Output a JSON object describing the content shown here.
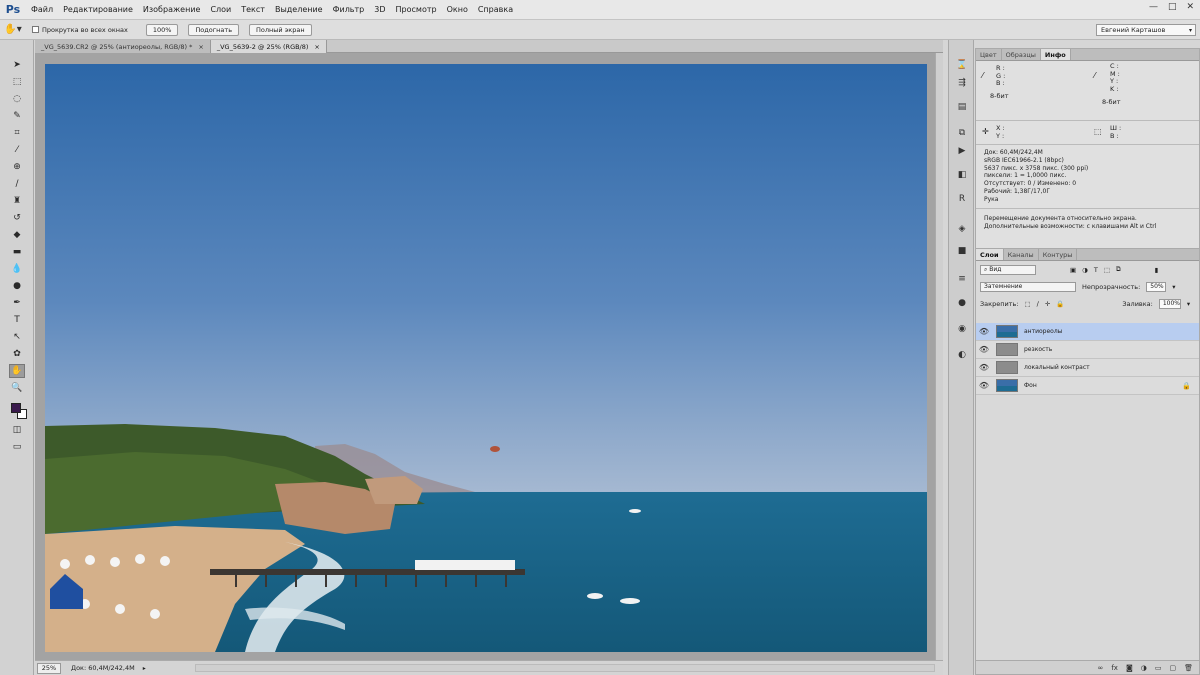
{
  "app": {
    "logo": "Ps",
    "menu": [
      "Файл",
      "Редактирование",
      "Изображение",
      "Слои",
      "Текст",
      "Выделение",
      "Фильтр",
      "3D",
      "Просмотр",
      "Окно",
      "Справка"
    ],
    "window_controls": [
      "—",
      "□",
      "✕"
    ]
  },
  "options": {
    "scroll_all_windows": "Прокрутка во всех окнах",
    "zoom_100": "100%",
    "fit_screen": "Подогнать",
    "full_screen": "Полный экран",
    "workspace": "Евгений Карташов"
  },
  "documents": {
    "tabs": [
      {
        "label": "_VG_5639.CR2 @ 25% (антиореолы, RGB/8) *",
        "close": "×"
      },
      {
        "label": "_VG_5639-2 @ 25% (RGB/8)",
        "close": "×"
      }
    ]
  },
  "status": {
    "zoom": "25%",
    "doc_size": "Док: 60,4M/242,4M"
  },
  "info_panel": {
    "tabs": [
      "Цвет",
      "Образцы",
      "Инфо"
    ],
    "rgb_labels": [
      "R :",
      "G :",
      "B :"
    ],
    "cmyk_labels": [
      "C :",
      "M :",
      "Y :",
      "K :"
    ],
    "bit_left": "8-бит",
    "bit_right": "8-бит",
    "xy_labels": [
      "X :",
      "Y :"
    ],
    "wh_labels": [
      "Ш :",
      "В :"
    ],
    "details": [
      "Док: 60,4M/242,4M",
      "sRGB IEC61966-2.1 (8bpc)",
      "5637 пикс. x 3758 пикс. (300 ppi)",
      "пиксели: 1 = 1,0000 пикс.",
      "Отсутствует: 0 / Изменено: 0",
      "Рабочий: 1,38Г/17,0Г",
      "Рука"
    ],
    "hint": "Перемещение документа относительно экрана. Дополнительные возможности: с клавишами Alt и Ctrl"
  },
  "layers_panel": {
    "tabs": [
      "Слои",
      "Каналы",
      "Контуры"
    ],
    "filter": "Вид",
    "blend_mode": "Затемнение",
    "opacity_label": "Непрозрачность:",
    "opacity_value": "50%",
    "lock_label": "Закрепить:",
    "fill_label": "Заливка:",
    "fill_value": "100%",
    "layers": [
      {
        "name": "антиореолы",
        "selected": true,
        "thumb": "photo"
      },
      {
        "name": "резкость",
        "selected": false,
        "thumb": "gray"
      },
      {
        "name": "локальный контраст",
        "selected": false,
        "thumb": "gray"
      },
      {
        "name": "Фон",
        "selected": false,
        "thumb": "photo",
        "locked": true
      }
    ]
  }
}
